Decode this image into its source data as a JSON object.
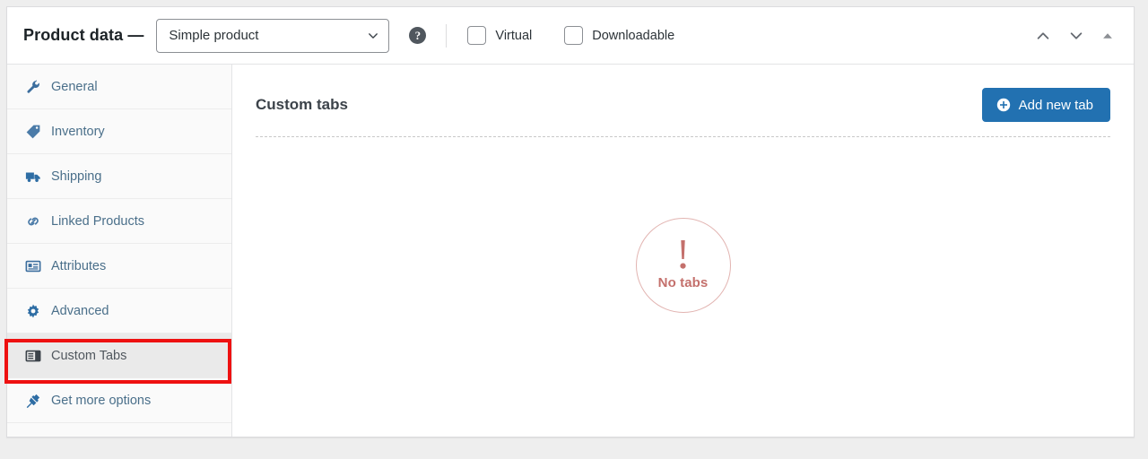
{
  "panel": {
    "title": "Product data —",
    "product_type": {
      "value": "Simple product",
      "icon": "chevron-down-icon"
    },
    "help_tip": {
      "icon": "help-icon",
      "label": "?"
    },
    "checkboxes": [
      {
        "label": "Virtual",
        "checked": false
      },
      {
        "label": "Downloadable",
        "checked": false
      }
    ],
    "header_actions": [
      {
        "name": "move-up-button",
        "icon": "chevron-up-icon"
      },
      {
        "name": "move-down-button",
        "icon": "chevron-down-icon"
      },
      {
        "name": "toggle-panel-button",
        "icon": "triangle-up-icon"
      }
    ]
  },
  "sidebar": {
    "items": [
      {
        "label": "General",
        "icon": "wrench-icon",
        "active": false
      },
      {
        "label": "Inventory",
        "icon": "tag-icon",
        "active": false
      },
      {
        "label": "Shipping",
        "icon": "truck-icon",
        "active": false
      },
      {
        "label": "Linked Products",
        "icon": "link-icon",
        "active": false
      },
      {
        "label": "Attributes",
        "icon": "attributes-icon",
        "active": false
      },
      {
        "label": "Advanced",
        "icon": "gear-icon",
        "active": false
      },
      {
        "label": "Custom Tabs",
        "icon": "custom-tabs-icon",
        "active": true
      },
      {
        "label": "Get more options",
        "icon": "plugin-icon",
        "active": false
      }
    ],
    "highlight": {
      "target": "Custom Tabs",
      "color": "#ee1111"
    }
  },
  "content": {
    "title": "Custom tabs",
    "add_button": {
      "label": "Add new tab",
      "icon": "plus-circle-icon",
      "color": "#2271b1"
    },
    "empty_state": {
      "icon": "exclamation-icon",
      "label": "No tabs",
      "color": "#c4706c"
    }
  }
}
